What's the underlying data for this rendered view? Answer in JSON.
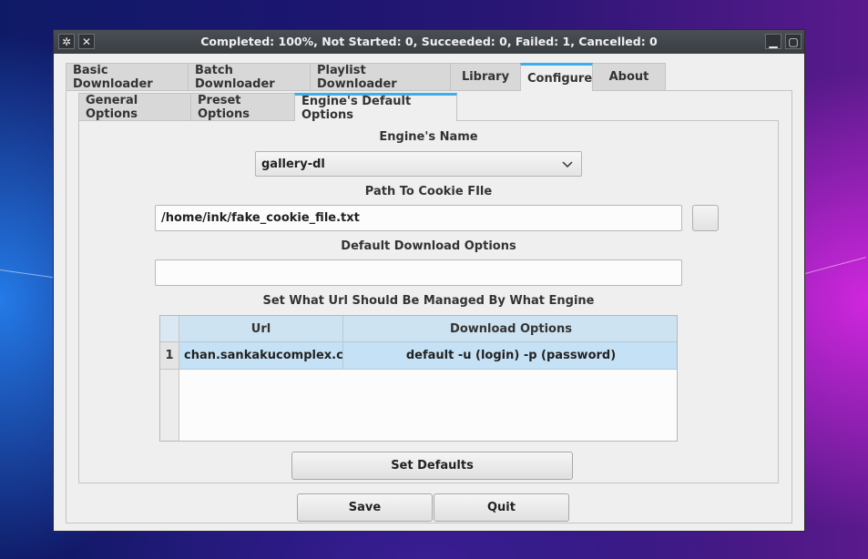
{
  "window": {
    "title": "Completed: 100%, Not Started: 0, Succeeded: 0, Failed: 1, Cancelled: 0"
  },
  "main_tabs": [
    {
      "label": "Basic Downloader"
    },
    {
      "label": "Batch Downloader"
    },
    {
      "label": "Playlist Downloader"
    },
    {
      "label": "Library"
    },
    {
      "label": "Configure",
      "active": true
    },
    {
      "label": "About"
    }
  ],
  "sub_tabs": [
    {
      "label": "General Options"
    },
    {
      "label": "Preset Options"
    },
    {
      "label": "Engine's Default Options",
      "active": true
    }
  ],
  "engine": {
    "name_label": "Engine's Name",
    "selected": "gallery-dl"
  },
  "cookie": {
    "label": "Path To Cookie FIle",
    "value": "/home/ink/fake_cookie_file.txt"
  },
  "download_options": {
    "label": "Default Download Options",
    "value": ""
  },
  "url_table": {
    "label": "Set What Url Should Be Managed By What Engine",
    "columns": [
      "Url",
      "Download Options"
    ],
    "rows": [
      {
        "num": "1",
        "url": "chan.sankakucomplex.c…",
        "options": "default -u (login) -p (password)"
      }
    ]
  },
  "buttons": {
    "set_defaults": "Set Defaults",
    "save": "Save",
    "quit": "Quit"
  },
  "colors": {
    "accent": "#3daee9",
    "selection": "#c5e1f5"
  }
}
